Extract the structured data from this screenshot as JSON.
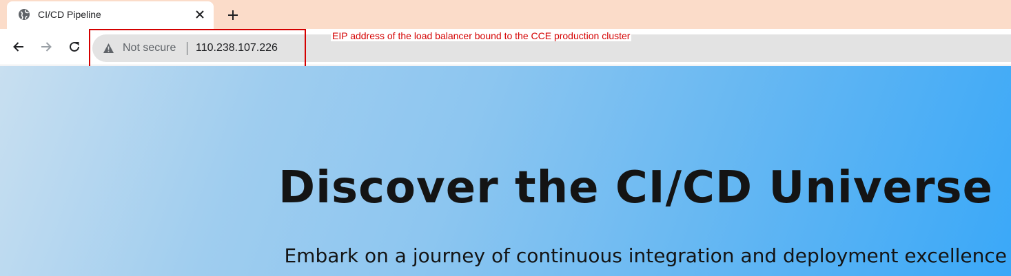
{
  "browser": {
    "tab": {
      "title": "CI/CD Pipeline",
      "favicon": "globe-icon",
      "close_icon": "close-icon"
    },
    "new_tab_icon": "plus-icon",
    "nav": {
      "back_icon": "back-arrow-icon",
      "forward_icon": "forward-arrow-icon",
      "reload_icon": "reload-icon"
    },
    "address_bar": {
      "security_icon": "warning-triangle-icon",
      "security_label": "Not secure",
      "url": "110.238.107.226"
    }
  },
  "annotation": {
    "text": "EIP address of the load balancer bound to the CCE production cluster",
    "color": "#d40000"
  },
  "page": {
    "hero_title": "Discover the CI/CD Universe",
    "hero_subtitle": "Embark on a journey of continuous integration and deployment excellence"
  },
  "colors": {
    "tabstrip_bg": "#fbdcc9",
    "omnibox_bg": "#e3e3e3",
    "page_gradient_start": "#c8dff0",
    "page_gradient_end": "#3aa8f8"
  }
}
